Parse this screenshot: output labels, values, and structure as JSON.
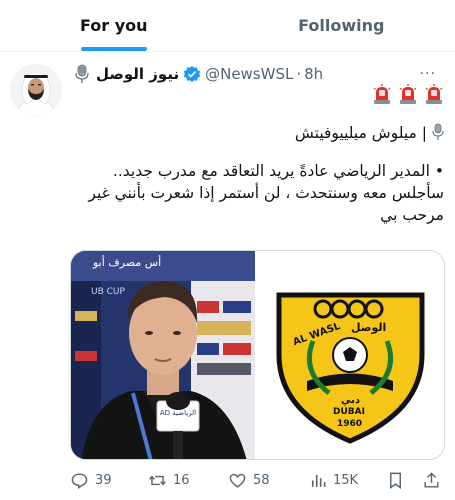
{
  "tabs": [
    {
      "label": "For you",
      "active": true
    },
    {
      "label": "Following",
      "active": false
    }
  ],
  "post": {
    "author_name": "نيوز الوصل",
    "handle": "@NewsWSL",
    "separator": "·",
    "time": "8h",
    "more": "···",
    "line1": "| ميلوش ميلييوفيتش",
    "line2": "• المدير الرياضي عادةً يريد التعاقد مع مدرب جديد..",
    "line3": "سأجلس معه وسنتحدث ، لن أستمر إذا شعرت بأنني غير مرحب بي",
    "media": {
      "banner_text": "أس مصرف أبو",
      "cup_text": "UB CUP",
      "mic_label": "AD الرياضية",
      "club_name_ar": "الوصل",
      "club_name_en": "AL WASL",
      "club_city": "DUBAI",
      "club_city_ar": "دبي",
      "club_year": "1960"
    }
  },
  "actions": {
    "replies": "39",
    "reposts": "16",
    "likes": "58",
    "views": "15K"
  },
  "colors": {
    "accent": "#1d9bf0",
    "muted": "#536471",
    "club_yellow": "#f5c518",
    "siren_red": "#e0312b"
  },
  "icons": [
    "microphone-icon",
    "verified-badge-icon",
    "siren-icon",
    "reply-icon",
    "repost-icon",
    "like-icon",
    "views-icon",
    "bookmark-icon",
    "share-icon",
    "more-icon"
  ]
}
